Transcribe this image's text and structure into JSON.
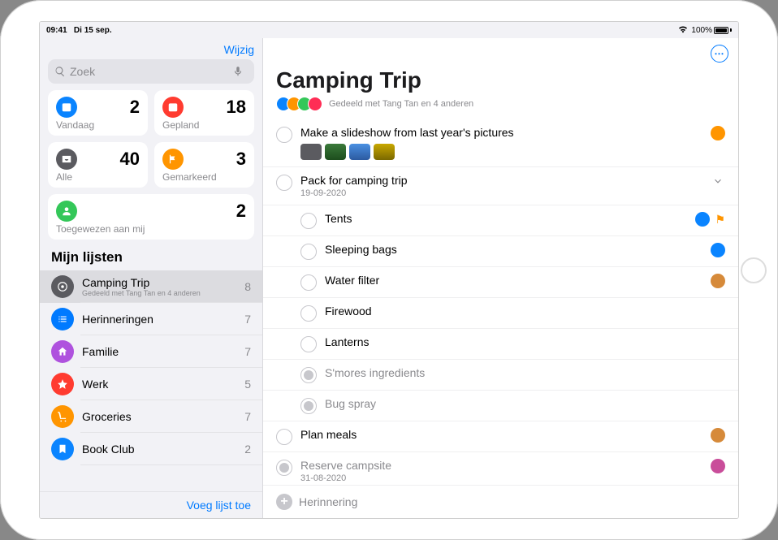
{
  "status": {
    "time": "09:41",
    "date": "Di 15 sep.",
    "battery": "100%"
  },
  "sidebar": {
    "edit": "Wijzig",
    "search_placeholder": "Zoek",
    "smart": {
      "today": {
        "label": "Vandaag",
        "count": "2"
      },
      "scheduled": {
        "label": "Gepland",
        "count": "18"
      },
      "all": {
        "label": "Alle",
        "count": "40"
      },
      "flagged": {
        "label": "Gemarkeerd",
        "count": "3"
      },
      "assigned": {
        "label": "Toegewezen aan mij",
        "count": "2"
      }
    },
    "section_title": "Mijn lijsten",
    "lists": [
      {
        "name": "Camping Trip",
        "sub": "Gedeeld met Tang Tan en 4 anderen",
        "count": "8",
        "color": "#5b5b60",
        "icon": "target",
        "selected": true
      },
      {
        "name": "Herinneringen",
        "sub": "",
        "count": "7",
        "color": "#007aff",
        "icon": "list"
      },
      {
        "name": "Familie",
        "sub": "",
        "count": "7",
        "color": "#af52de",
        "icon": "home"
      },
      {
        "name": "Werk",
        "sub": "",
        "count": "5",
        "color": "#ff3b30",
        "icon": "star"
      },
      {
        "name": "Groceries",
        "sub": "",
        "count": "7",
        "color": "#ff9500",
        "icon": "cart"
      },
      {
        "name": "Book Club",
        "sub": "",
        "count": "2",
        "color": "#0a84ff",
        "icon": "bookmark"
      }
    ],
    "add_list": "Voeg lijst toe"
  },
  "main": {
    "title": "Camping Trip",
    "shared_text": "Gedeeld met Tang Tan en 4 anderen",
    "avatars": [
      "#0a84ff",
      "#ff9500",
      "#34c759",
      "#ff2d55"
    ],
    "reminders": [
      {
        "title": "Make a slideshow from last year's pictures",
        "assignee_color": "#ff9500",
        "thumbs": [
          "#5b5b60",
          "linear-gradient(#3a7a3a,#1d4d1d)",
          "linear-gradient(#4a90e2,#2c5aa0)",
          "linear-gradient(#c9a800,#7a6800)"
        ]
      },
      {
        "title": "Pack for camping trip",
        "date": "19-09-2020",
        "expandable": true,
        "children": [
          {
            "title": "Tents",
            "assignee_color": "#0a84ff",
            "flagged": true
          },
          {
            "title": "Sleeping bags",
            "assignee_color": "#0a84ff"
          },
          {
            "title": "Water filter",
            "assignee_color": "#d68a3a"
          },
          {
            "title": "Firewood"
          },
          {
            "title": "Lanterns"
          },
          {
            "title": "S'mores ingredients",
            "done": true
          },
          {
            "title": "Bug spray",
            "done": true
          }
        ]
      },
      {
        "title": "Plan meals",
        "assignee_color": "#d68a3a"
      },
      {
        "title": "Reserve campsite",
        "date": "31-08-2020",
        "done": true,
        "assignee_color": "#c94d9a"
      }
    ],
    "new_reminder": "Herinnering"
  }
}
